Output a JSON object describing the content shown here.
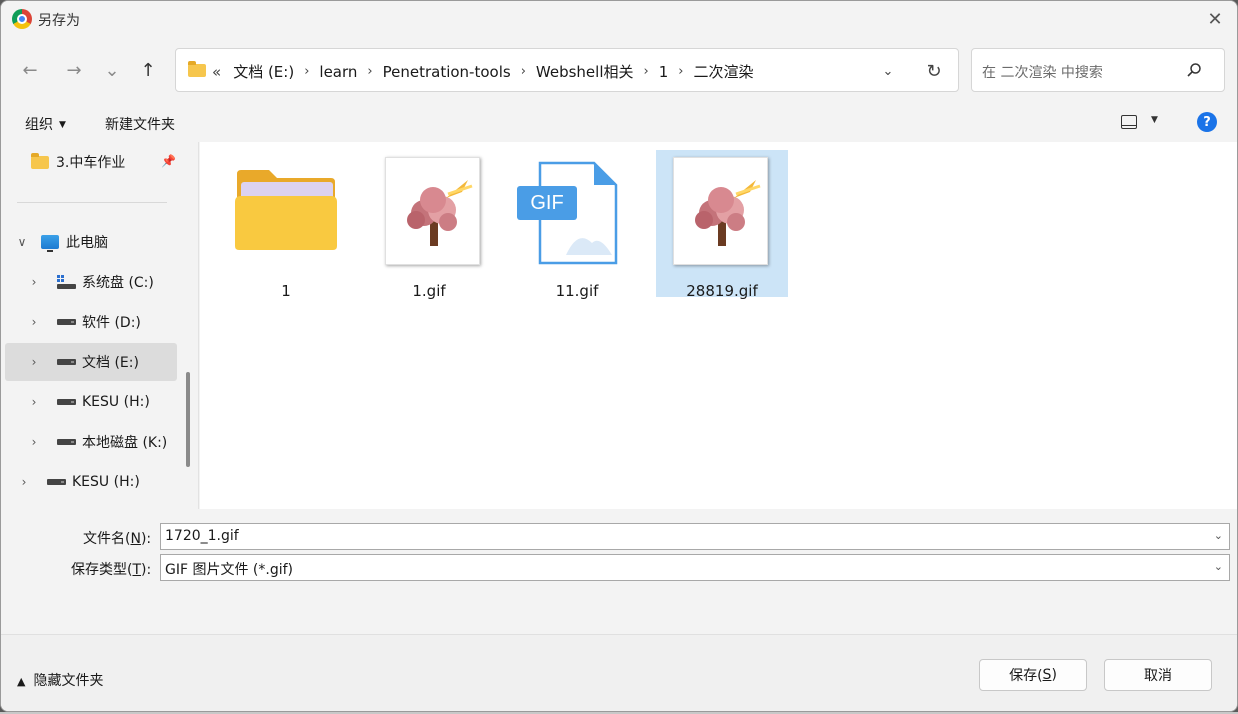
{
  "window": {
    "title": "另存为"
  },
  "nav": {
    "back": "←",
    "forward": "→",
    "recent": "⌄",
    "up": "↑"
  },
  "address": {
    "overflow": "«",
    "crumbs": [
      "文档 (E:)",
      "learn",
      "Penetration-tools",
      "Webshell相关",
      "1",
      "二次渲染"
    ],
    "separator": "›"
  },
  "search": {
    "placeholder": "在 二次渲染 中搜索"
  },
  "toolbar": {
    "organize": "组织",
    "new_folder": "新建文件夹",
    "help": "?"
  },
  "tree": {
    "quick_item": "3.中车作业",
    "this_pc": "此电脑",
    "drives": [
      "系统盘 (C:)",
      "软件 (D:)",
      "文档 (E:)",
      "KESU (H:)",
      "本地磁盘 (K:)"
    ],
    "extra_drive": "KESU (H:)"
  },
  "files": [
    {
      "name": "1",
      "kind": "folder"
    },
    {
      "name": "1.gif",
      "kind": "image"
    },
    {
      "name": "11.gif",
      "kind": "gif-icon",
      "badge": "GIF"
    },
    {
      "name": "28819.gif",
      "kind": "image",
      "selected": true
    }
  ],
  "form": {
    "filename_label": "文件名(",
    "filename_key": "N",
    "filename_label_end": "):",
    "filename_value": "1720_1.gif",
    "type_label": "保存类型(",
    "type_key": "T",
    "type_label_end": "):",
    "type_value": "GIF 图片文件 (*.gif)"
  },
  "footer": {
    "hide_folders": "隐藏文件夹",
    "save_label": "保存(",
    "save_key": "S",
    "save_end": ")",
    "cancel_label": "取消"
  },
  "colors": {
    "accent": "#1a73e8",
    "selection": "#cce4f7",
    "folder": "#f6c64d",
    "gif_badge": "#4a9de6"
  }
}
